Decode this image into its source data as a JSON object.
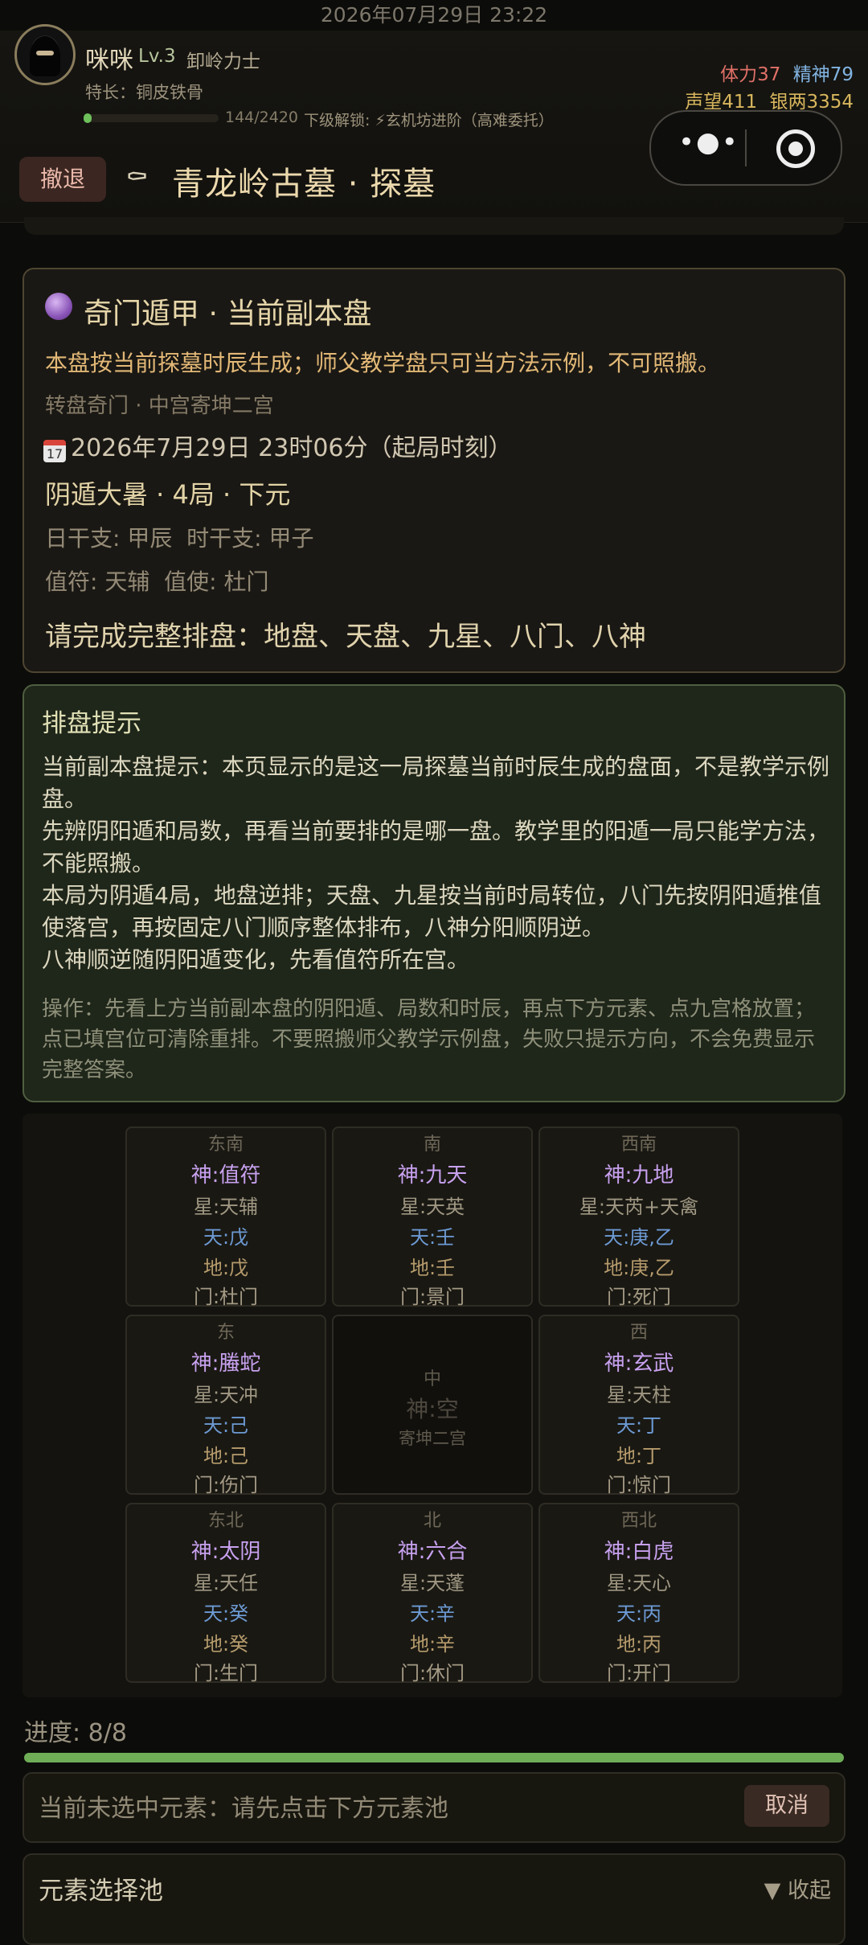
{
  "status_bar": {
    "datetime": "2026年07月29日 23:22"
  },
  "player": {
    "name": "咪咪",
    "level": "Lv.3",
    "title": "卸岭力士",
    "specialty": "特长：铜皮铁骨",
    "xp": "144/2420",
    "xp_fraction": 0.06,
    "next_unlock": "下级解锁: ⚡玄机坊进阶（高难委托）",
    "stamina": "体力37",
    "spirit": "精神79",
    "reputation": "声望411",
    "silver": "银两3354"
  },
  "capsule": {
    "more_icon": "more-dots-icon",
    "close_icon": "target-circle-icon"
  },
  "nav": {
    "retreat_label": "撤退",
    "dungeon_title": "青龙岭古墓 · 探墓",
    "title_icon": "coffin-icon"
  },
  "info_card": {
    "title": "奇门遁甲 · 当前副本盘",
    "title_icon": "crystal-ball-icon",
    "warning": "本盘按当前探墓时辰生成；师父教学盘只可当方法示例，不可照搬。",
    "method": "转盘奇门 · 中宫寄坤二宫",
    "calendar_icon": "17",
    "datetime": "2026年7月29日 23时06分（起局时刻）",
    "ju": "阴遁大暑 · 4局 · 下元",
    "ganzhi": "日干支: 甲辰  时干支: 甲子",
    "zhifu": "值符: 天辅  值使: 杜门",
    "task": "请完成完整排盘：地盘、天盘、九星、八门、八神"
  },
  "hint_card": {
    "title": "排盘提示",
    "paragraphs": [
      "当前副本盘提示：本页显示的是这一局探墓当前时辰生成的盘面，不是教学示例盘。",
      "先辨阴阳遁和局数，再看当前要排的是哪一盘。教学里的阳遁一局只能学方法，不能照搬。",
      "本局为阴遁4局，地盘逆排；天盘、九星按当前时局转位，八门先按阴阳遁推值使落宫，再按固定八门顺序整体排布，八神分阳顺阴逆。",
      "八神顺逆随阴阳遁变化，先看值符所在宫。"
    ],
    "operation": "操作：先看上方当前副本盘的阴阳遁、局数和时辰，再点下方元素、点九宫格放置；点已填宫位可清除重排。不要照搬师父教学示例盘，失败只提示方向，不会免费显示完整答案。"
  },
  "board": {
    "cells": [
      {
        "dir": "东南",
        "shen": "神:值符",
        "xing": "星:天辅",
        "tian": "天:戊",
        "di": "地:戊",
        "men": "门:杜门"
      },
      {
        "dir": "南",
        "shen": "神:九天",
        "xing": "星:天英",
        "tian": "天:壬",
        "di": "地:壬",
        "men": "门:景门"
      },
      {
        "dir": "西南",
        "shen": "神:九地",
        "xing": "星:天芮+天禽",
        "tian": "天:庚,乙",
        "di": "地:庚,乙",
        "men": "门:死门"
      },
      {
        "dir": "东",
        "shen": "神:螣蛇",
        "xing": "星:天冲",
        "tian": "天:己",
        "di": "地:己",
        "men": "门:伤门"
      },
      {
        "dir": "西",
        "shen": "神:玄武",
        "xing": "星:天柱",
        "tian": "天:丁",
        "di": "地:丁",
        "men": "门:惊门"
      },
      {
        "dir": "东北",
        "shen": "神:太阴",
        "xing": "星:天任",
        "tian": "天:癸",
        "di": "地:癸",
        "men": "门:生门"
      },
      {
        "dir": "北",
        "shen": "神:六合",
        "xing": "星:天蓬",
        "tian": "天:辛",
        "di": "地:辛",
        "men": "门:休门"
      },
      {
        "dir": "西北",
        "shen": "神:白虎",
        "xing": "星:天心",
        "tian": "天:丙",
        "di": "地:丙",
        "men": "门:开门"
      }
    ],
    "center": {
      "dir": "中",
      "shen": "神:空",
      "note": "寄坤二宫"
    }
  },
  "progress": {
    "label": "进度: 8/8",
    "fraction": 1.0
  },
  "selection": {
    "text": "当前未选中元素：请先点击下方元素池",
    "cancel_label": "取消"
  },
  "pool": {
    "title": "元素选择池",
    "collapse_label": "▼ 收起"
  },
  "colors": {
    "accent_green": "#6fae57",
    "shen_purple": "#c8a1ef",
    "tian_blue": "#6d9ad4",
    "di_tan": "#b69b6c"
  }
}
